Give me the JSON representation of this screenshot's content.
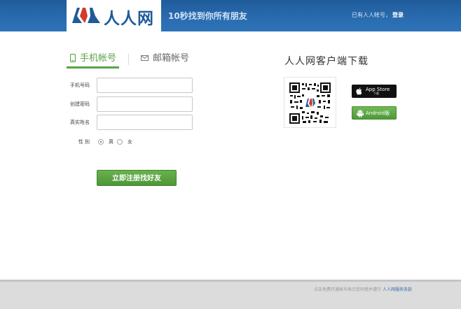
{
  "header": {
    "logo_text": "人人网",
    "slogan": "10秒找到你所有朋友",
    "have_account": "已有人人帐号，",
    "login": "登录"
  },
  "tabs": [
    {
      "label": "手机帐号",
      "active": true,
      "icon": "phone-icon"
    },
    {
      "label": "邮箱帐号",
      "active": false,
      "icon": "mail-icon"
    }
  ],
  "form": {
    "phone_label": "手机号码",
    "phone_value": "",
    "password_label": "创建密码",
    "password_value": "",
    "name_label": "真实姓名",
    "name_value": "",
    "gender_label": "性 别",
    "gender_male": "男",
    "gender_female": "女",
    "gender_selected": "男",
    "submit_label": "立即注册找好友"
  },
  "client": {
    "title": "人人网客户端下载",
    "qr_icon": "qr-code",
    "appstore_label": "App Store",
    "appstore_sub": "下载",
    "android_label": "Android版"
  },
  "footer": {
    "text": "点击免费开通帐号表示您同意并遵守",
    "link": "人人网服务条款"
  },
  "colors": {
    "header_blue": "#2a6cb0",
    "accent_green": "#5aa24a",
    "link_blue": "#3a6ea8"
  }
}
